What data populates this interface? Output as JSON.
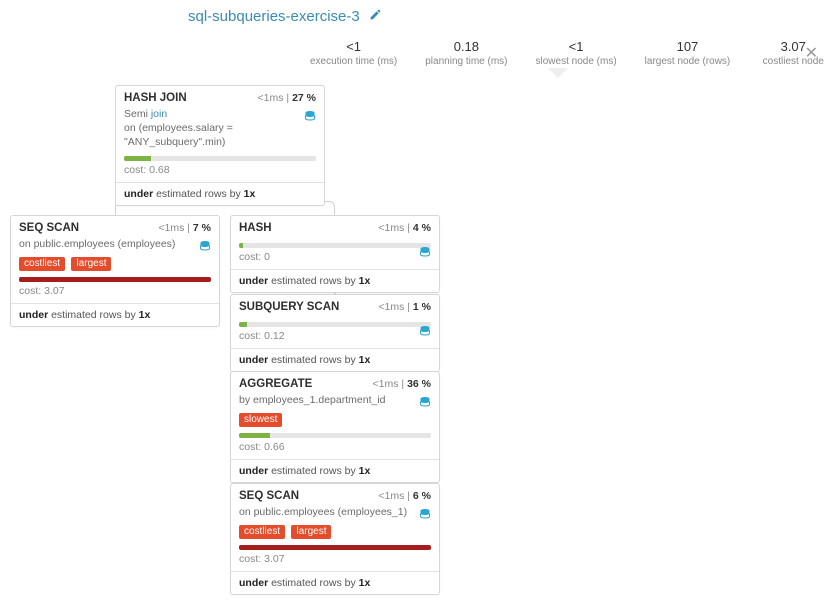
{
  "title": "sql-subqueries-exercise-3",
  "stats": {
    "exec_time_val": "<1",
    "exec_time_lbl": "execution time (ms)",
    "plan_time_val": "0.18",
    "plan_time_lbl": "planning time (ms)",
    "slowest_val": "<1",
    "slowest_lbl": "slowest node (ms)",
    "largest_val": "107",
    "largest_lbl": "largest node (rows)",
    "costliest_val": "3.07",
    "costliest_lbl": "costliest node"
  },
  "nodes": {
    "hash_join": {
      "title": "HASH JOIN",
      "time": "<1ms",
      "pct": "27 %",
      "detail_prefix": "Semi ",
      "detail_join": "join",
      "detail_on": "on (employees.salary = \"ANY_subquery\".min)",
      "cost": "cost: 0.68",
      "est_prefix": "under",
      "est_mid": " estimated rows by ",
      "est_val": "1x",
      "bar_pct": 14,
      "bar_color": "bar-green"
    },
    "seq_scan_1": {
      "title": "SEQ SCAN",
      "time": "<1ms",
      "pct": "7 %",
      "detail": "on public.employees (employees)",
      "badges": [
        "costliest",
        "largest"
      ],
      "cost": "cost: 3.07",
      "est_prefix": "under",
      "est_mid": " estimated rows by ",
      "est_val": "1x",
      "bar_pct": 100,
      "bar_color": "bar-red"
    },
    "hash": {
      "title": "HASH",
      "time": "<1ms",
      "pct": "4 %",
      "cost": "cost: 0",
      "est_prefix": "under",
      "est_mid": " estimated rows by ",
      "est_val": "1x",
      "bar_pct": 2,
      "bar_color": "bar-green"
    },
    "subquery": {
      "title": "SUBQUERY SCAN",
      "time": "<1ms",
      "pct": "1 %",
      "cost": "cost: 0.12",
      "est_prefix": "under",
      "est_mid": " estimated rows by ",
      "est_val": "1x",
      "bar_pct": 4,
      "bar_color": "bar-green"
    },
    "aggregate": {
      "title": "AGGREGATE",
      "time": "<1ms",
      "pct": "36 %",
      "detail": "by employees_1.department_id",
      "badges": [
        "slowest"
      ],
      "cost": "cost: 0.66",
      "est_prefix": "under",
      "est_mid": " estimated rows by ",
      "est_val": "1x",
      "bar_pct": 16,
      "bar_color": "bar-green"
    },
    "seq_scan_2": {
      "title": "SEQ SCAN",
      "time": "<1ms",
      "pct": "6 %",
      "detail": "on public.employees (employees_1)",
      "badges": [
        "costliest",
        "largest"
      ],
      "cost": "cost: 3.07",
      "est_prefix": "under",
      "est_mid": " estimated rows by ",
      "est_val": "1x",
      "bar_pct": 100,
      "bar_color": "bar-red"
    }
  }
}
